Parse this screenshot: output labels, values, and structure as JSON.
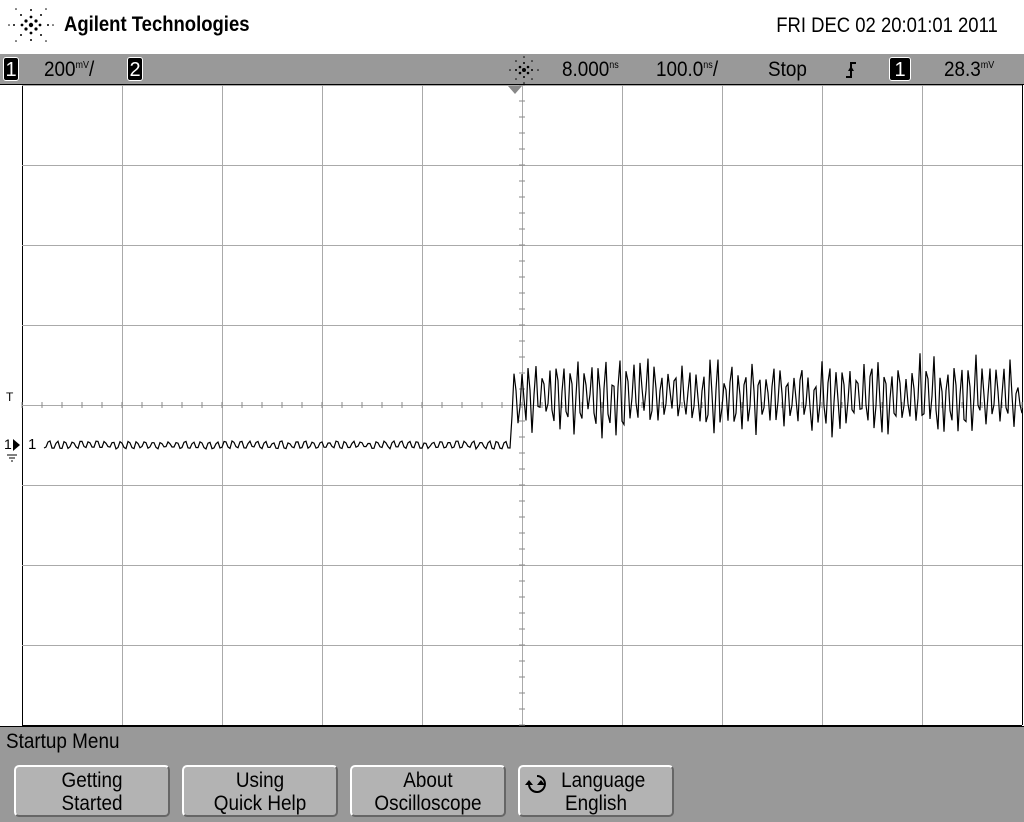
{
  "header": {
    "brand": "Agilent Technologies",
    "datetime": "FRI DEC 02 20:01:01 2011"
  },
  "status": {
    "ch1_label": "1",
    "ch1_scale": "200",
    "ch1_unit": "mV",
    "ch1_suffix": "/",
    "ch2_label": "2",
    "time_delay": "8.000",
    "time_delay_unit": "ns",
    "time_scale": "100.0",
    "time_scale_unit": "ns",
    "time_scale_suffix": "/",
    "run_state": "Stop",
    "trigger_slope": "rising-edge",
    "trigger_source": "1",
    "trigger_level": "28.3",
    "trigger_level_unit": "mV"
  },
  "graticule": {
    "h_divisions": 10,
    "v_divisions": 8
  },
  "trace": {
    "channel_marker": "1",
    "trigger_marker": "T",
    "ground_marker": "1",
    "step_time_div": 4.9,
    "pre_level_div": -0.5,
    "post_level_div": 0.1,
    "pre_noise_div": 0.1,
    "post_noise_div": 0.5
  },
  "menu": {
    "title": "Startup Menu",
    "buttons": [
      {
        "line1": "Getting",
        "line2": "Started"
      },
      {
        "line1": "Using",
        "line2": "Quick Help"
      },
      {
        "line1": "About",
        "line2": "Oscilloscope"
      },
      {
        "line1": "Language",
        "line2": "English"
      }
    ]
  }
}
